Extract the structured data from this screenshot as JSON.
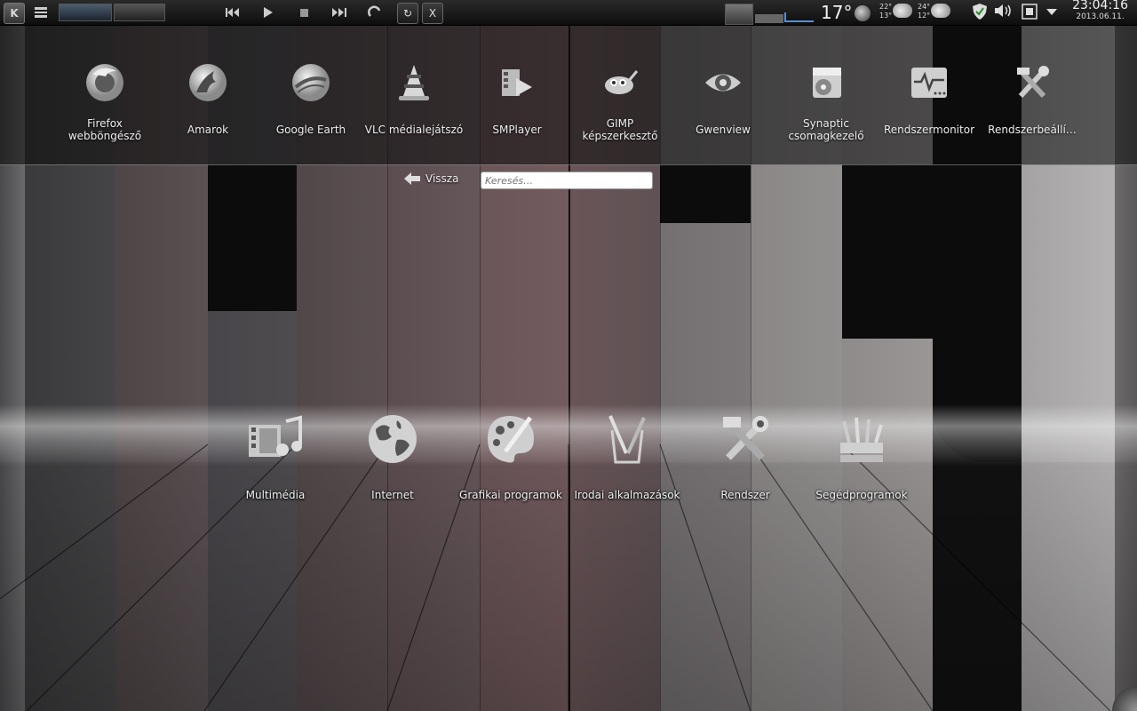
{
  "panel": {
    "kde_menu_icon": "kde-logo-icon",
    "temperature": "17°",
    "forecast": [
      {
        "high": "22°",
        "low": "13°",
        "icon": "rain-cloud-icon"
      },
      {
        "high": "24°",
        "low": "12°",
        "icon": "cloud-icon"
      }
    ],
    "clock": {
      "time": "23:04:16",
      "date": "2013.06.11."
    },
    "media_controls": [
      "previous",
      "play",
      "stop",
      "next"
    ]
  },
  "favorites": [
    {
      "label": "Firefox webböngésző",
      "icon": "firefox-icon"
    },
    {
      "label": "Amarok",
      "icon": "amarok-icon"
    },
    {
      "label": "Google Earth",
      "icon": "google-earth-icon"
    },
    {
      "label": "VLC médialejátszó",
      "icon": "vlc-icon"
    },
    {
      "label": "SMPlayer",
      "icon": "smplayer-icon"
    },
    {
      "label": "GIMP képszerkesztő",
      "icon": "gimp-icon"
    },
    {
      "label": "Gwenview",
      "icon": "gwenview-icon"
    },
    {
      "label": "Synaptic csomagkezelő",
      "icon": "synaptic-icon"
    },
    {
      "label": "Rendszermonitor",
      "icon": "system-monitor-icon"
    },
    {
      "label": "Rendszerbeállí…",
      "icon": "system-settings-icon"
    }
  ],
  "nav": {
    "back_label": "Vissza",
    "search_placeholder": "Keresés…"
  },
  "categories": [
    {
      "label": "Multimédia",
      "icon": "multimedia-icon"
    },
    {
      "label": "Internet",
      "icon": "globe-icon"
    },
    {
      "label": "Grafikai programok",
      "icon": "palette-icon"
    },
    {
      "label": "Irodai alkalmazások",
      "icon": "office-icon"
    },
    {
      "label": "Rendszer",
      "icon": "tools-icon"
    },
    {
      "label": "Segédprogramok",
      "icon": "utilities-icon"
    }
  ]
}
